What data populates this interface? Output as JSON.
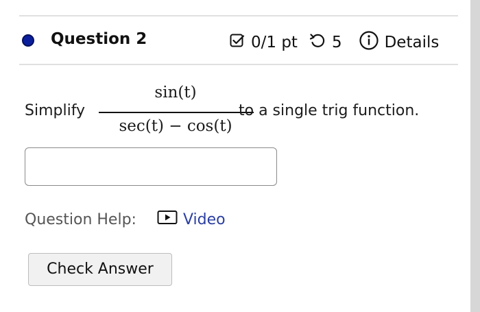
{
  "question": {
    "title": "Question 2",
    "score": "0/1 pt",
    "attempts": "5",
    "details_label": "Details",
    "status_color": "#0b1f9c"
  },
  "problem": {
    "prefix": "Simplify",
    "numerator": "sin(t)",
    "denominator": "sec(t) − cos(t)",
    "suffix": "to a single trig function."
  },
  "answer_input": {
    "value": "",
    "placeholder": ""
  },
  "help": {
    "label": "Question Help:",
    "video_label": "Video",
    "link_color": "#2b3fa0"
  },
  "actions": {
    "check_label": "Check Answer"
  },
  "icons": [
    "checkbox-score-icon",
    "retry-icon",
    "info-icon",
    "video-icon"
  ]
}
